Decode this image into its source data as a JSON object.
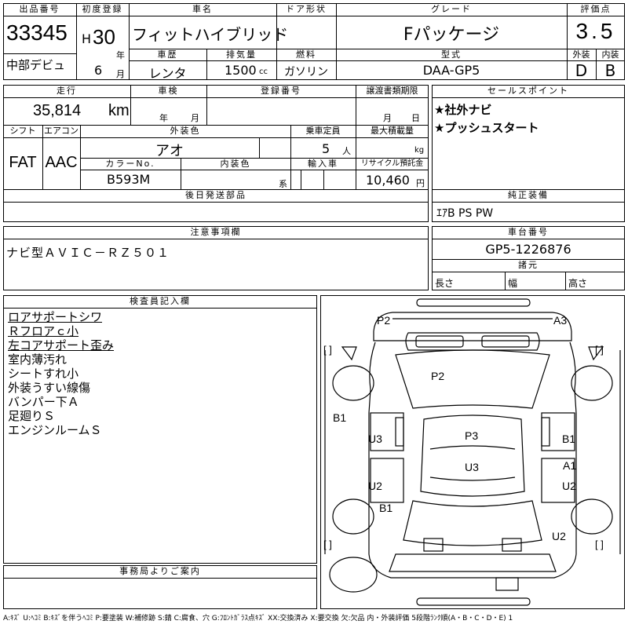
{
  "header": {
    "lot_no_label": "出品番号",
    "lot_no": "33345",
    "debut": "中部デビュ",
    "first_reg_label": "初度登録",
    "era": "H",
    "year": "30",
    "year_unit": "年",
    "month": "6",
    "month_unit": "月",
    "car_name_label": "車名",
    "car_name": "フィットハイブリッド",
    "door_label": "ドア形状",
    "grade_label": "グレード",
    "grade": "Fパッケージ",
    "score_label": "評価点",
    "score": "3.5",
    "history_label": "車歴",
    "history": "レンタ",
    "displacement_label": "排気量",
    "displacement": "1500",
    "displacement_unit": "cc",
    "fuel_label": "燃料",
    "fuel": "ガソリン",
    "model_label": "型式",
    "model": "DAA-GP5",
    "exterior_label": "外装",
    "exterior": "D",
    "interior_label": "内装",
    "interior": "B"
  },
  "row2": {
    "mileage_label": "走行",
    "mileage": "35,814",
    "mileage_unit": "km",
    "inspection_label": "車検",
    "inspection_year_unit": "年",
    "inspection_month_unit": "月",
    "reg_no_label": "登録番号",
    "transfer_label": "譲渡書類期限",
    "transfer_month_unit": "月",
    "transfer_day_unit": "日",
    "shift_label": "シフト",
    "shift": "FAT",
    "aircon_label": "エアコン",
    "aircon": "AAC",
    "ext_color_label": "外装色",
    "ext_color": "アオ",
    "capacity_label": "乗車定員",
    "capacity": "5",
    "capacity_unit": "人",
    "max_load_label": "最大積載量",
    "max_load_unit": "kg",
    "color_no_label": "カラーNo.",
    "color_no": "B593M",
    "int_color_label": "内装色",
    "int_color_unit": "系",
    "import_label": "輸入車",
    "recycle_label": "リサイクル預託金",
    "recycle": "10,460",
    "recycle_unit": "円",
    "later_parts_label": "後日発送部品"
  },
  "sales": {
    "label": "セールスポイント",
    "items": [
      "★社外ナビ",
      "★プッシュスタート"
    ],
    "equip_label": "純正装備",
    "equip": "ｴｱB PS PW"
  },
  "caution": {
    "label": "注意事項欄",
    "text": "ナビ型ＡＶＩＣ－ＲＺ５０１"
  },
  "chassis": {
    "label": "車台番号",
    "number": "GP5-1226876",
    "dims_label": "諸元",
    "length_label": "長さ",
    "width_label": "幅",
    "height_label": "高さ"
  },
  "inspector": {
    "label": "検査員記入欄",
    "notes": [
      {
        "text": "ロアサポートシワ",
        "underline": true
      },
      {
        "text": "Ｒフロアｃ小",
        "underline": true
      },
      {
        "text": "左コアサポート歪み",
        "underline": true
      },
      {
        "text": "室内薄汚れ",
        "underline": false
      },
      {
        "text": "シートすれ小",
        "underline": false
      },
      {
        "text": "外装うすい線傷",
        "underline": false
      },
      {
        "text": "バンパー下Ａ",
        "underline": false
      },
      {
        "text": "足廻りＳ",
        "underline": false
      },
      {
        "text": "エンジンルームＳ",
        "underline": false
      }
    ]
  },
  "diagram": {
    "labels": [
      "P2",
      "A3",
      "P2",
      "B1",
      "U3",
      "P3",
      "B1",
      "U3",
      "A1",
      "U2",
      "U2",
      "B1",
      "U2"
    ],
    "bracket": "[  ]"
  },
  "office": {
    "label": "事務局よりご案内"
  },
  "footer": "A:ｷｽﾞ U:ﾍｺﾐ B:ｷｽﾞを伴うﾍｺﾐ P:要塗装 W:補修跡 S:錆 C:腐食、穴 G:ﾌﾛﾝﾄｶﾞﾗｽ点ｷｽﾞ XX:交換済み X:要交換 欠:欠品 内・外装評価 5段階ﾗﾝｸ順(A・B・C・D・E) 1"
}
